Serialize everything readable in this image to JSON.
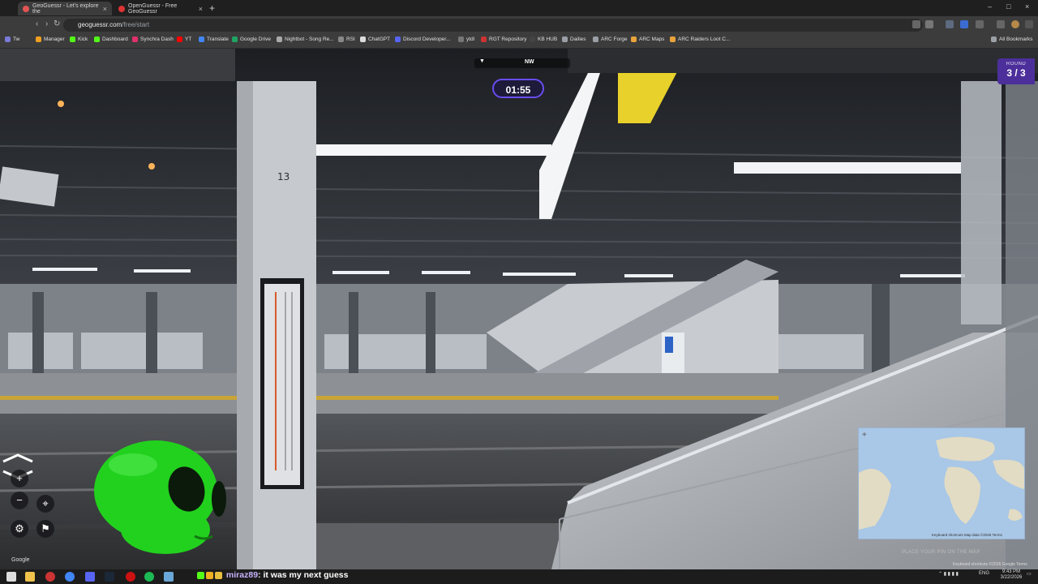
{
  "browser": {
    "tabs": [
      {
        "title": "GeoGuessr - Let's explore the",
        "active": true
      },
      {
        "title": "OpenGuessr - Free GeoGuessr",
        "active": false
      }
    ],
    "url_host": "geoguessr.com",
    "url_path": "/free/start",
    "bookmarks": [
      "Tw",
      "Manager",
      "Kick",
      "Dashboard",
      "Synchra Dash",
      "YT",
      "Translate",
      "Google Drive",
      "Nightbot - Song Re...",
      "RSI",
      "ChatGPT",
      "Discord Developer...",
      "ytdl",
      "RGT Repository",
      "KB HUB",
      "Dailies",
      "ARC Forge",
      "ARC Maps",
      "ARC Raiders Loot C..."
    ],
    "all_bookmarks": "All Bookmarks"
  },
  "game": {
    "round_label": "ROUND",
    "round_value": "3 / 3",
    "timer": "01:55",
    "compass_heading": "NW",
    "platform_number": "13",
    "google_watermark": "Google",
    "place_pin_hint": "PLACE YOUR PIN ON THE MAP",
    "map_attribution": "Keyboard shortcuts   Map data ©2026   Terms",
    "keyboard_shortcuts": "Keyboard shortcuts  ©2026 Google  Terms"
  },
  "chat_overlay": {
    "username": "miraz89",
    "message": ": it was my next guess"
  },
  "taskbar": {
    "language": "ENG",
    "time": "9:43 PM",
    "date": "3/22/2026"
  },
  "colors": {
    "accent_purple": "#6a4cf0",
    "round_bg": "#4c2f9b",
    "alien_green": "#22d11e"
  }
}
